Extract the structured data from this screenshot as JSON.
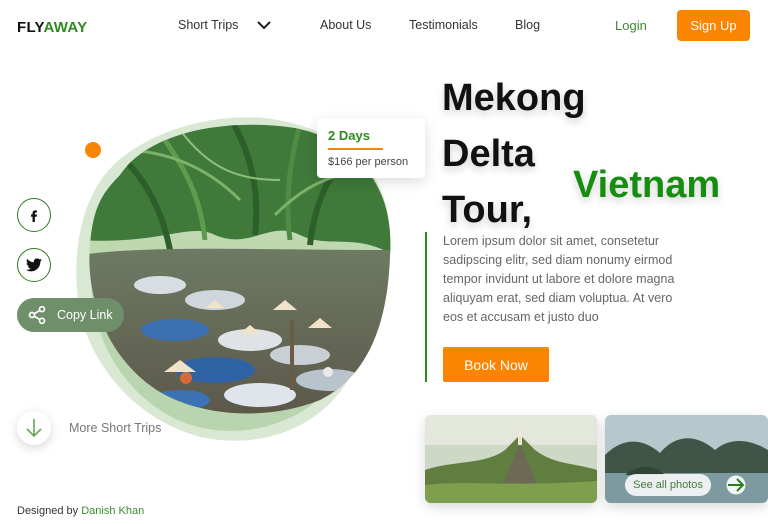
{
  "brand": {
    "part1": "FLY",
    "part2": "AWAY"
  },
  "nav": {
    "items": [
      "Short Trips",
      "About Us",
      "Testimonials",
      "Blog"
    ],
    "login": "Login",
    "signup": "Sign Up"
  },
  "tour_card": {
    "duration": "2 Days",
    "price": "$166 per person"
  },
  "hero": {
    "title_lines": [
      "Mekong",
      "Delta",
      "Tour,"
    ],
    "title_accent": "Vietnam",
    "description": "Lorem ipsum dolor sit amet, consetetur sadipscing elitr, sed diam nonumy eirmod tempor invidunt ut labore et dolore magna aliquyam erat, sed diam voluptua. At vero eos et accusam et justo duo",
    "cta": "Book Now"
  },
  "share": {
    "copy_link": "Copy Link"
  },
  "more_trips": "More Short Trips",
  "gallery": {
    "see_all": "See all photos"
  },
  "footer": {
    "designed_by": "Designed by",
    "designer": "Danish Khan"
  },
  "colors": {
    "accent_orange": "#fb8500",
    "brand_green": "#2e8b1f",
    "title_green": "#178d0f"
  }
}
